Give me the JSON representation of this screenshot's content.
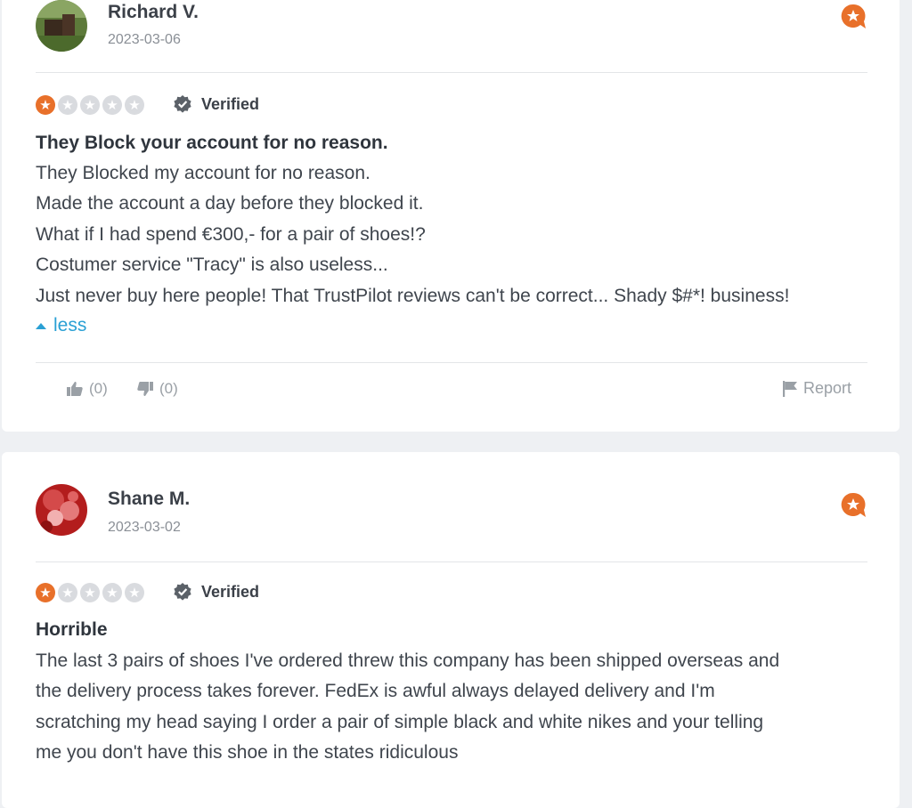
{
  "reviews": [
    {
      "author": "Richard V.",
      "date": "2023-03-06",
      "rating": 1,
      "verified_label": "Verified",
      "title": "They Block your account for no reason.",
      "body_lines": [
        "They Blocked my account for no reason.",
        "Made the account a day before they blocked it.",
        "What if I had spend €300,- for a pair of shoes!?",
        "Costumer service \"Tracy\" is also useless...",
        "Just never buy here people! That TrustPilot reviews can't be correct... Shady $#*! business!"
      ],
      "toggle_label": "less",
      "likes": "(0)",
      "dislikes": "(0)",
      "report_label": "Report"
    },
    {
      "author": "Shane M.",
      "date": "2023-03-02",
      "rating": 1,
      "verified_label": "Verified",
      "title": "Horrible",
      "body_lines": [
        "The last 3 pairs of shoes I've ordered threw this company has been shipped overseas and",
        "the delivery process takes forever. FedEx is awful always delayed delivery and I'm",
        "scratching my head saying I order a pair of simple black and white nikes and your telling",
        "me you don't have this shoe in the states ridiculous"
      ]
    }
  ],
  "colors": {
    "accent": "#e8702a",
    "link": "#2aa0d4",
    "background": "#eef0f3"
  },
  "icons": [
    "review-source-icon",
    "verified-icon",
    "thumbs-up-icon",
    "thumbs-down-icon",
    "flag-icon",
    "caret-up-icon",
    "star-icon"
  ]
}
